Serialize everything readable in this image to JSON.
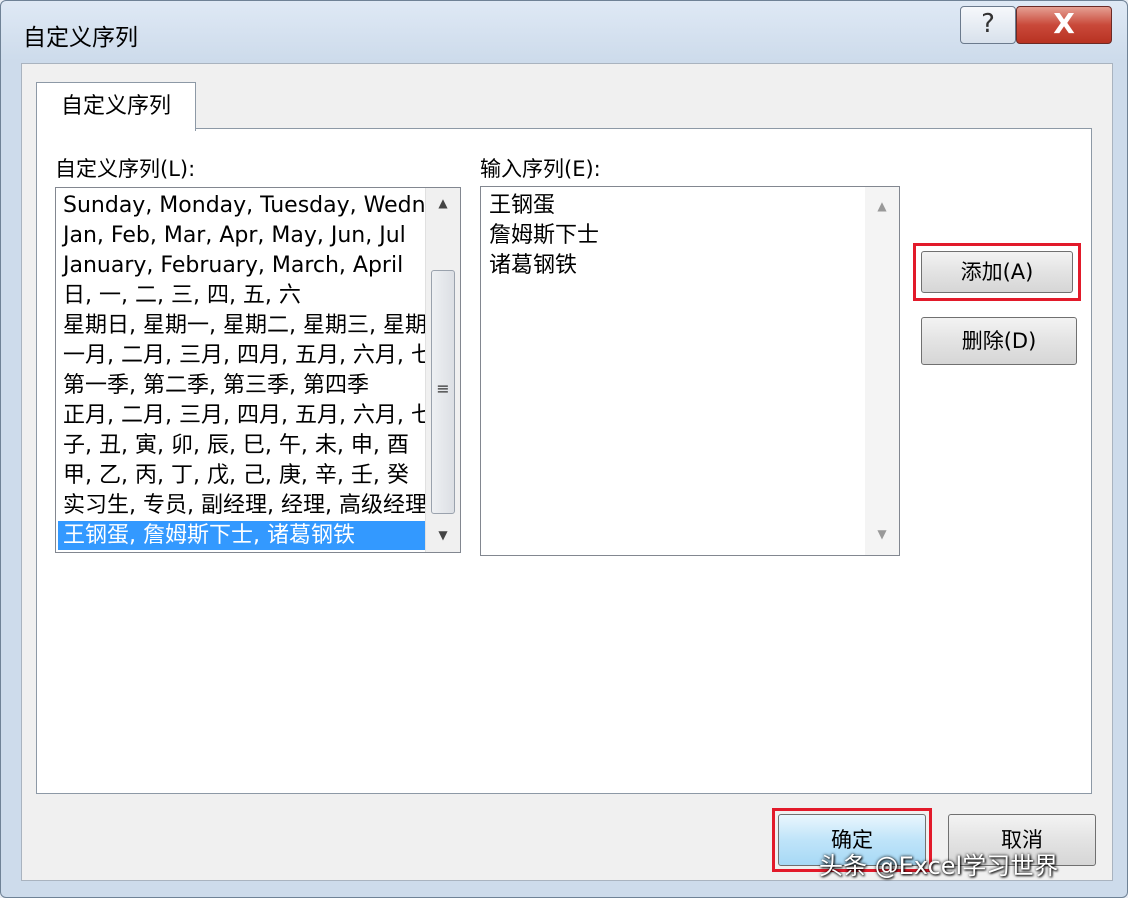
{
  "window": {
    "title": "自定义序列",
    "help_glyph": "?",
    "close_glyph": "X"
  },
  "tab": {
    "label": "自定义序列"
  },
  "custom_lists": {
    "label": "自定义序列(L):",
    "items": [
      "Sunday, Monday, Tuesday, Wednesday",
      "Jan, Feb, Mar, Apr, May, Jun, Jul",
      "January, February, March, April",
      "日, 一, 二, 三, 四, 五, 六",
      "星期日, 星期一, 星期二, 星期三, 星期四",
      "一月, 二月, 三月, 四月, 五月, 六月, 七月",
      "第一季, 第二季, 第三季, 第四季",
      "正月, 二月, 三月, 四月, 五月, 六月, 七月",
      "子, 丑, 寅, 卯, 辰, 巳, 午, 未, 申, 酉",
      "甲, 乙, 丙, 丁, 戊, 己, 庚, 辛, 壬, 癸",
      "实习生, 专员, 副经理, 经理, 高级经理",
      "王钢蛋, 詹姆斯下士, 诸葛钢铁"
    ],
    "selected_index": 11
  },
  "entries": {
    "label": "输入序列(E):",
    "lines": [
      "王钢蛋",
      "詹姆斯下士",
      "诸葛钢铁"
    ]
  },
  "buttons": {
    "add": "添加(A)",
    "delete": "删除(D)",
    "ok": "确定",
    "cancel": "取消"
  },
  "watermark": "头条 @Excel学习世界",
  "colors": {
    "selection": "#3399ff",
    "highlight_box": "#e21a2a",
    "close_button": "#c9493a"
  }
}
